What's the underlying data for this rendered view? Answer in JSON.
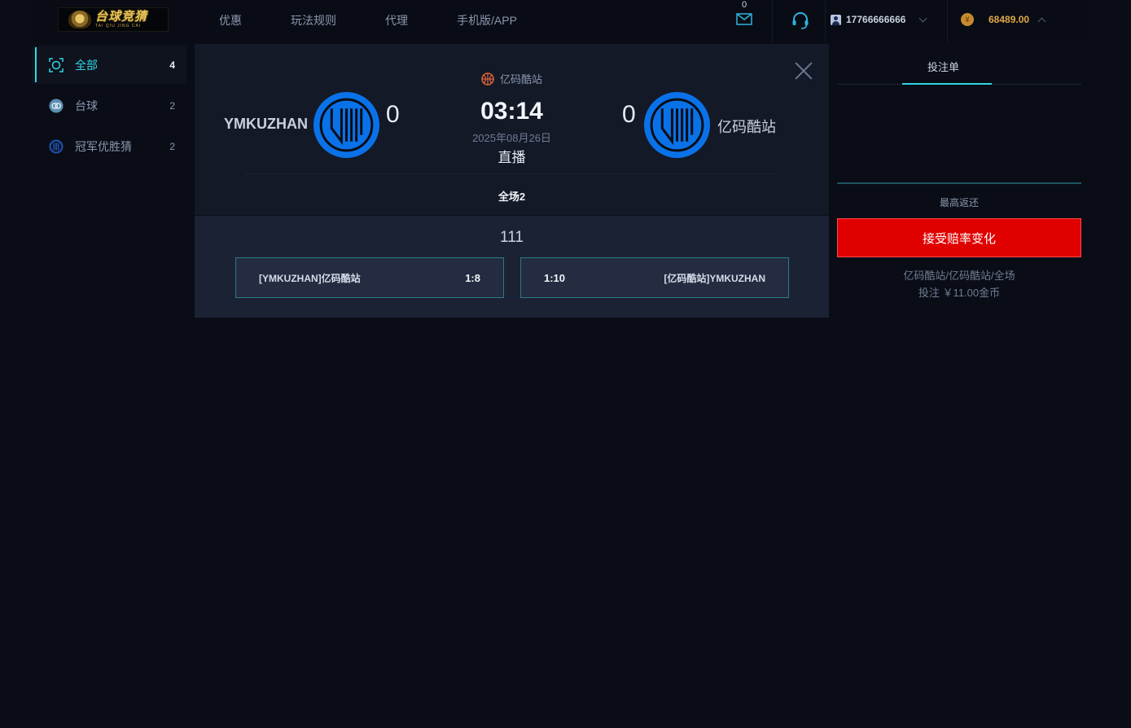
{
  "header": {
    "logo": {
      "main": "台球竞猜",
      "sub": "TAI QIU JING CAI"
    },
    "nav": [
      "优惠",
      "玩法规则",
      "代理",
      "手机版/APP"
    ],
    "mail_count": "0",
    "username": "17766666666",
    "balance": "68489.00",
    "coin_symbol": "¥"
  },
  "sidebar": {
    "items": [
      {
        "label": "全部",
        "count": "4",
        "icon": "all-icon",
        "active": true
      },
      {
        "label": "台球",
        "count": "2",
        "icon": "billiards-icon",
        "active": false
      },
      {
        "label": "冠军优胜猜",
        "count": "2",
        "icon": "champion-icon",
        "active": false
      }
    ]
  },
  "match": {
    "league": "亿码酷站",
    "home": {
      "name": "YMKUZHAN",
      "score": "0"
    },
    "away": {
      "name": "亿码酷站",
      "score": "0"
    },
    "time": "03:14",
    "date": "2025年08月26日",
    "status": "直播",
    "period": "全场2",
    "market": {
      "title": "111",
      "options": [
        {
          "label": "[YMKUZHAN]亿码酷站",
          "odds": "1:8"
        },
        {
          "label": "[亿码酷站]YMKUZHAN",
          "odds": "1:10"
        }
      ]
    }
  },
  "slip": {
    "tab": "投注单",
    "max_return": "最高返还",
    "accept_button": "接受赔率变化",
    "selection": "亿码酷站/亿码酷站/全场",
    "stake": "投注 ￥11.00金币"
  },
  "colors": {
    "accent": "#33d6e6",
    "accept_red": "#e00000",
    "balance_gold": "#e2a84a",
    "team_logo_blue": "#0a72e8"
  }
}
